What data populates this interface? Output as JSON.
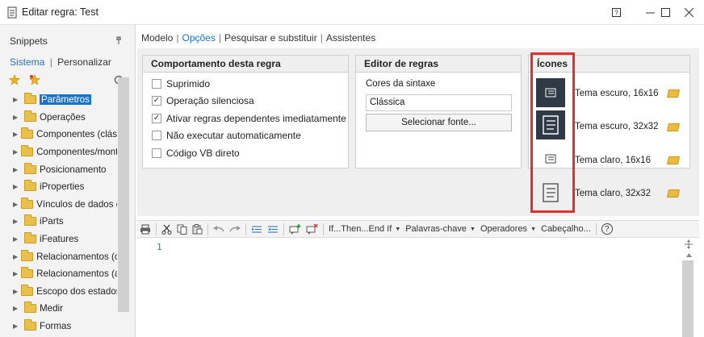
{
  "window": {
    "title": "Editar regra: Test"
  },
  "snippets": {
    "header": "Snippets",
    "tabs": [
      "Sistema",
      "Personalizar"
    ],
    "tab_separator": "|",
    "items": [
      {
        "label": "Parâmetros",
        "selected": true
      },
      {
        "label": "Operações"
      },
      {
        "label": "Componentes (cláss"
      },
      {
        "label": "Componentes/mont"
      },
      {
        "label": "Posicionamento"
      },
      {
        "label": "iProperties"
      },
      {
        "label": "Vínculos de dados d"
      },
      {
        "label": "iParts"
      },
      {
        "label": "iFeatures"
      },
      {
        "label": "Relacionamentos (c"
      },
      {
        "label": "Relacionamentos (a"
      },
      {
        "label": "Escopo dos estados"
      },
      {
        "label": "Medir"
      },
      {
        "label": "Formas"
      }
    ]
  },
  "top_tabs": [
    "Modelo",
    "Opções",
    "Pesquisar e substituir",
    "Assistentes"
  ],
  "behavior": {
    "title": "Comportamento desta regra",
    "options": [
      {
        "label": "Suprimido",
        "checked": false
      },
      {
        "label": "Operação silenciosa",
        "checked": true
      },
      {
        "label": "Ativar regras dependentes imediatamente",
        "checked": true
      },
      {
        "label": "Não executar automaticamente",
        "checked": false
      },
      {
        "label": "Código VB direto",
        "checked": false
      }
    ]
  },
  "editor_group": {
    "title": "Editor de regras",
    "syntax_label": "Cores da sintaxe",
    "syntax_value": "Clássica",
    "font_button": "Selecionar fonte..."
  },
  "icons": {
    "title": "Ícones",
    "items": [
      {
        "label": "Tema escuro, 16x16",
        "icon": "scroll-icon-dark-small"
      },
      {
        "label": "Tema escuro, 32x32",
        "icon": "scroll-icon-dark-large"
      },
      {
        "label": "Tema claro, 16x16",
        "icon": "scroll-icon-light-small"
      },
      {
        "label": "Tema claro, 32x32",
        "icon": "scroll-icon-light-large"
      }
    ],
    "highlight_color": "#e03030"
  },
  "toolbar": {
    "ifthen": "If...Then...End If",
    "keywords": "Palavras-chave",
    "operators": "Operadores",
    "header": "Cabeçalho...",
    "help": "?"
  },
  "code": {
    "line_number": "1"
  },
  "colors": {
    "accent": "#1874c8",
    "star": "#f0b21c"
  }
}
